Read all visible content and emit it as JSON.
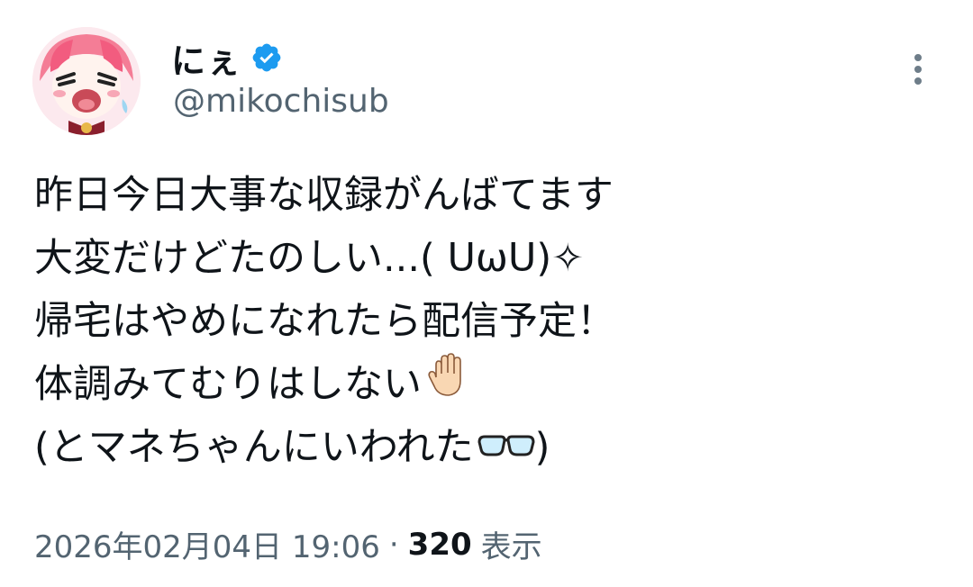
{
  "author": {
    "display_name": "にぇ",
    "handle": "@mikochisub",
    "verified_icon": "verified-badge-icon",
    "avatar_icon": "anime-avatar",
    "verified_color": "#1d9bf0"
  },
  "tweet": {
    "lines": [
      "昨日今日大事な収録がんばてます",
      "大変だけどたのしい...( ᑌωᑌ)✧",
      "帰宅はやめになれたら配信予定！",
      "体調みてむりはしない",
      "(とマネちゃんにいわれた"
    ],
    "line4_emoji": "raised-hand-emoji",
    "line5_emoji": "glasses-emoji",
    "line5_suffix": ")"
  },
  "meta": {
    "timestamp": "2026年02月04日 19:06",
    "separator": "·",
    "views_count": "320",
    "views_label": "表示"
  },
  "menu": {
    "more_icon": "more-options-icon"
  }
}
